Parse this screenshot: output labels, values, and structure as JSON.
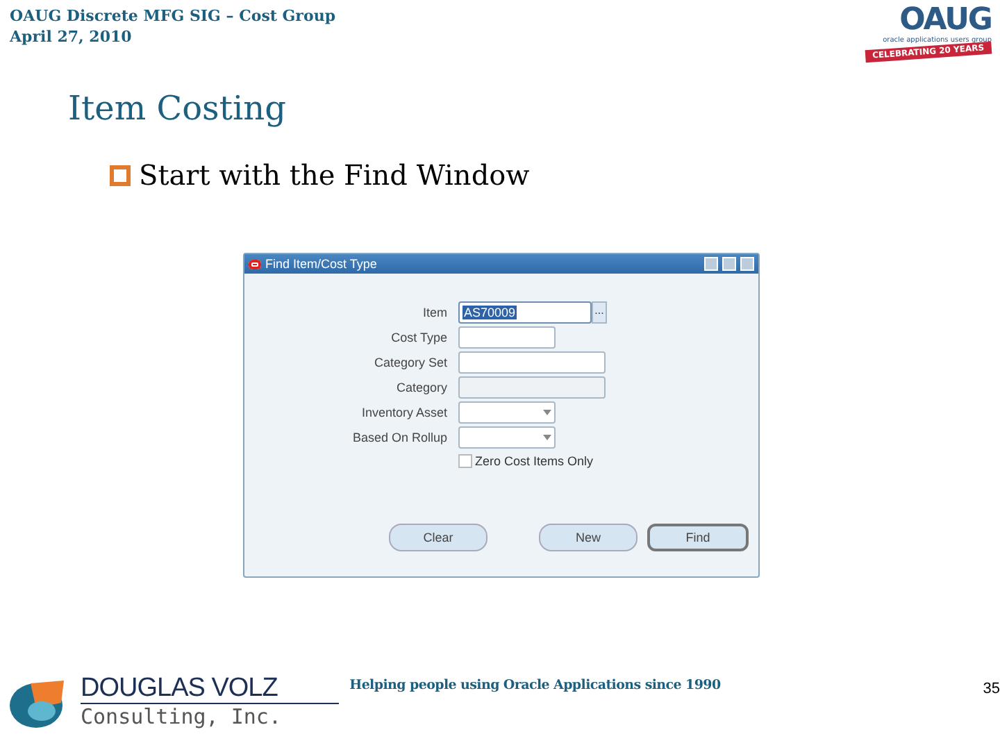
{
  "header": {
    "line_1": "OAUG Discrete MFG SIG – Cost Group",
    "line_2": "April 27, 2010"
  },
  "logo": {
    "name": "OAUG",
    "tagline": "oracle applications users group",
    "banner": "CELEBRATING 20 YEARS"
  },
  "title": "Item Costing",
  "bullets": [
    "Start with the Find Window"
  ],
  "window": {
    "title": "Find Item/Cost Type",
    "fields": [
      {
        "kind": "lov",
        "label": "Item",
        "value": "AS70009",
        "button": "...",
        "selected": true
      },
      {
        "kind": "text",
        "label": "Cost Type",
        "selected": false
      },
      {
        "kind": "wide",
        "label": "Category Set",
        "selected": false
      },
      {
        "kind": "disabled",
        "label": "Category",
        "selected": false
      },
      {
        "kind": "select",
        "label": "Inventory Asset",
        "selected": false
      },
      {
        "kind": "select",
        "label": "Based On Rollup",
        "selected": false
      }
    ],
    "checkbox": {
      "label": "Zero Cost Items Only",
      "checked": false
    },
    "buttons": [
      {
        "label": "Clear",
        "default": false
      },
      {
        "label": "New",
        "default": false
      },
      {
        "label": "Find",
        "default": true
      }
    ]
  },
  "footer": {
    "company_1": "DOUGLAS VOLZ",
    "company_2": "Consulting, Inc.",
    "tagline": "Helping people using Oracle Applications since 1990",
    "page": "35"
  }
}
